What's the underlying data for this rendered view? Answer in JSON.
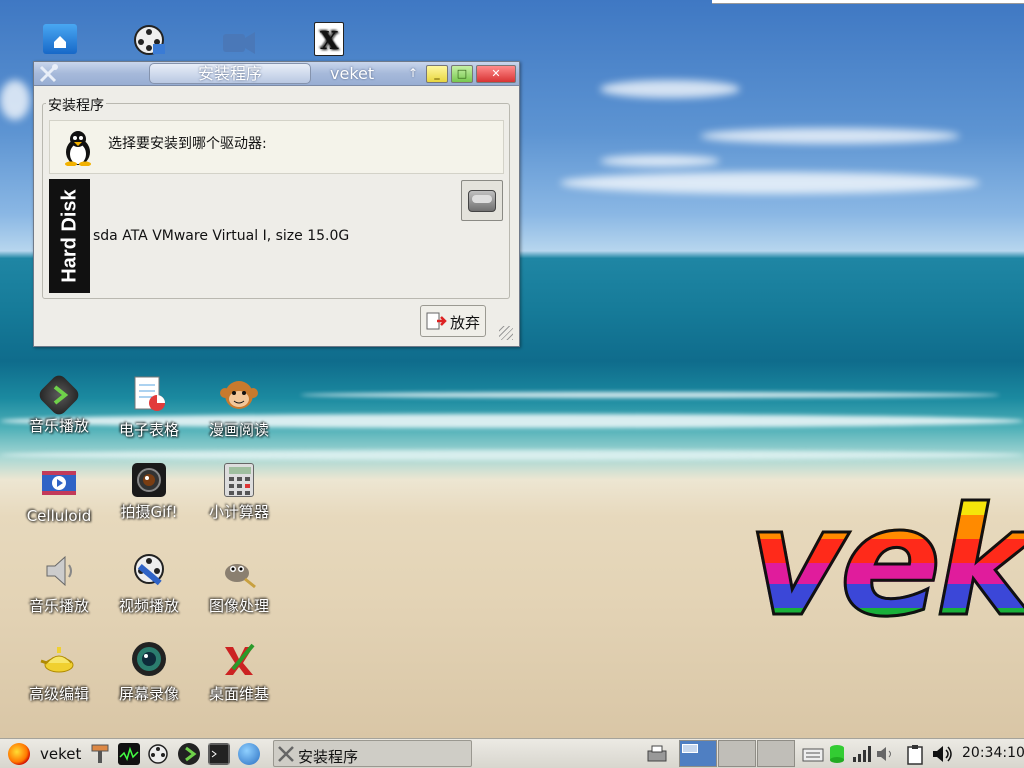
{
  "desktop": {
    "logo_text": "veket",
    "top_icons": [
      {
        "name": "home-folder-icon",
        "label": ""
      },
      {
        "name": "film-reel-icon",
        "label": ""
      },
      {
        "name": "video-camera-icon",
        "label": ""
      },
      {
        "name": "x-editor-icon",
        "label": ""
      }
    ],
    "icons": [
      {
        "name": "music-player-icon",
        "label": "音乐播放"
      },
      {
        "name": "spreadsheet-icon",
        "label": "电子表格"
      },
      {
        "name": "comic-reader-icon",
        "label": "漫画阅读"
      },
      {
        "name": "celluloid-icon",
        "label": "Celluloid"
      },
      {
        "name": "camera-gif-icon",
        "label": "拍摄Gif!"
      },
      {
        "name": "calculator-icon",
        "label": "小计算器"
      },
      {
        "name": "speaker-icon",
        "label": "音乐播放"
      },
      {
        "name": "video-player-icon",
        "label": "视频播放"
      },
      {
        "name": "gimp-icon",
        "label": "图像处理"
      },
      {
        "name": "lamp-editor-icon",
        "label": "高级编辑"
      },
      {
        "name": "screen-recorder-icon",
        "label": "屏幕录像"
      },
      {
        "name": "wiki-icon",
        "label": "桌面维基"
      }
    ]
  },
  "installer": {
    "tab_title": "安装程序",
    "window_title": "veket",
    "up_glyph": "↑",
    "min_glyph": "_",
    "max_glyph": "□",
    "close_glyph": "✕",
    "frame_label": "安装程序",
    "message": "选择要安装到哪个驱动器:",
    "drive_label": "Hard Disk",
    "drive_text": "sda ATA VMware Virtual I, size 15.0G",
    "cancel_label": "放弃"
  },
  "taskbar": {
    "start_label": "veket",
    "task_label": "安装程序",
    "clock": "20:34:10"
  }
}
